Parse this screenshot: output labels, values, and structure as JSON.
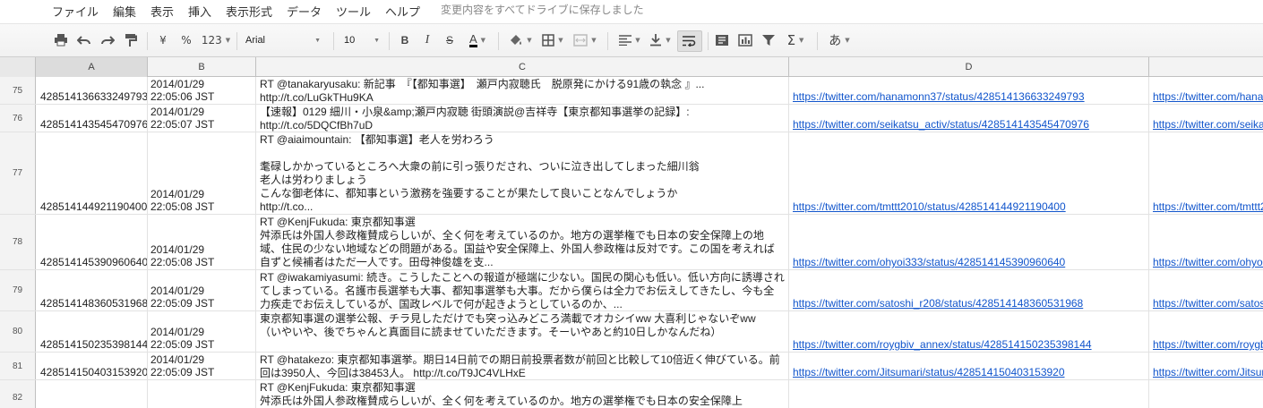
{
  "menu": {
    "items": [
      "ファイル",
      "編集",
      "表示",
      "挿入",
      "表示形式",
      "データ",
      "ツール",
      "ヘルプ"
    ],
    "save_status": "変更内容をすべてドライブに保存しました"
  },
  "toolbar": {
    "currency": "¥",
    "percent": "%",
    "number_format": "123",
    "font": "Arial",
    "font_size": "10",
    "bold": "B",
    "italic": "I",
    "strike": "S",
    "text_color": "A",
    "input_tools": "あ",
    "icons": [
      "print-icon",
      "undo-icon",
      "redo-icon",
      "paint-format-icon",
      "fill-color-icon",
      "borders-icon",
      "merge-cells-icon",
      "horizontal-align-icon",
      "vertical-align-icon",
      "wrap-text-icon",
      "comment-icon",
      "insert-chart-icon",
      "filter-icon",
      "functions-icon"
    ]
  },
  "columns": [
    "A",
    "B",
    "C",
    "D"
  ],
  "rows": [
    {
      "num": "75",
      "a": "428514136633249793",
      "date": "2014/01/29",
      "time": "22:05:06 JST",
      "text": "RT @tanakaryusaku: 新記事　『【都知事選】　瀬戸内寂聴氏　脱原発にかける91歳の執念 』...\nhttp://t.co/LuGkTHu9KA",
      "url": "https://twitter.com/hanamonn37/status/428514136633249793",
      "url2": "https://twitter.com/hanamonn37/status/428514136633249793"
    },
    {
      "num": "76",
      "a": "428514143545470976",
      "date": "2014/01/29",
      "time": "22:05:07 JST",
      "text": "【速報】0129 細川・小泉&amp;瀬戸内寂聴 街頭演説@吉祥寺【東京都知事選挙の記録】:\nhttp://t.co/5DQCfBh7uD",
      "url": "https://twitter.com/seikatsu_activ/status/428514143545470976",
      "url2": "https://twitter.com/seikatsu_activ/status/428514143545470976"
    },
    {
      "num": "77",
      "a": "428514144921190400",
      "date": "2014/01/29",
      "time": "22:05:08 JST",
      "text": "RT @aiaimountain: 【都知事選】老人を労わろう\n\n耄碌しかかっているところへ大衆の前に引っ張りだされ、ついに泣き出してしまった細川翁\n老人は労わりましょう\nこんな御老体に、都知事という激務を強要することが果たして良いことなんでしょうか\nhttp://t.co...",
      "url": "https://twitter.com/tmttt2010/status/428514144921190400",
      "url2": "https://twitter.com/tmttt2010/status/428514144921190400"
    },
    {
      "num": "78",
      "a": "428514145390960640",
      "date": "2014/01/29",
      "time": "22:05:08 JST",
      "text": "RT @KenjFukuda: 東京都知事選\n舛添氏は外国人参政権賛成らしいが、全く何を考えているのか。地方の選挙権でも日本の安全保障上の地域、住民の少ない地域などの問題がある。国益や安全保障上、外国人参政権は反対です。この国を考えれば自ずと候補者はただ一人です。田母神俊雄を支...",
      "url": "https://twitter.com/ohyoi333/status/428514145390960640",
      "url2": "https://twitter.com/ohyoi333/status/428514145390960640"
    },
    {
      "num": "79",
      "a": "428514148360531968",
      "date": "2014/01/29",
      "time": "22:05:09 JST",
      "text": "RT @iwakamiyasumi: 続き。こうしたことへの報道が極端に少ない。国民の関心も低い。低い方向に誘導されてしまっている。名護市長選挙も大事、都知事選挙も大事。だから僕らは全力でお伝えしてきたし、今も全力疾走でお伝えしているが、国政レベルで何が起きようとしているのか、...",
      "url": "https://twitter.com/satoshi_r208/status/428514148360531968",
      "url2": "https://twitter.com/satoshi_r208/status/428514148360531968"
    },
    {
      "num": "80",
      "a": "428514150235398144",
      "date": "2014/01/29",
      "time": "22:05:09 JST",
      "text": "東京都知事選の選挙公報、チラ見しただけでも突っ込みどころ満載でオカシイww 大喜利じゃないぞww\n（いやいや、後でちゃんと真面目に読ませていただきます。そーいやあと約10日しかなんだね）",
      "url": "https://twitter.com/roygbiv_annex/status/428514150235398144",
      "url2": "https://twitter.com/roygbiv_annex/status/428514150235398144"
    },
    {
      "num": "81",
      "a": "428514150403153920",
      "date": "2014/01/29",
      "time": "22:05:09 JST",
      "text": "RT @hatakezo: 東京都知事選挙。期日14日前での期日前投票者数が前回と比較して10倍近く伸びている。前回は3950人、今回は38453人。 http://t.co/T9JC4VLHxE",
      "url": "https://twitter.com/Jitsumari/status/428514150403153920",
      "url2": "https://twitter.com/Jitsumari/status/428514150403153920"
    },
    {
      "num": "82",
      "a": "",
      "date": "",
      "time": "",
      "text": "RT @KenjFukuda: 東京都知事選\n舛添氏は外国人参政権賛成らしいが、全く何を考えているのか。地方の選挙権でも日本の安全保障上",
      "url": "",
      "url2": ""
    }
  ]
}
